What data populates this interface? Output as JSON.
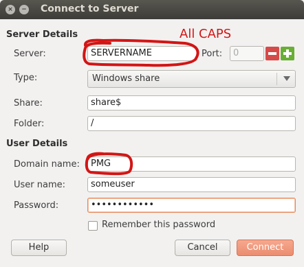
{
  "window": {
    "title": "Connect to Server",
    "close_icon": "×",
    "minimize_icon": "−"
  },
  "server_details": {
    "heading": "Server Details",
    "server_label": "Server:",
    "server_value": "SERVERNAME",
    "port_label": "Port:",
    "port_value": "0",
    "type_label": "Type:",
    "type_value": "Windows share",
    "share_label": "Share:",
    "share_value": "share$",
    "folder_label": "Folder:",
    "folder_value": "/"
  },
  "user_details": {
    "heading": "User Details",
    "domain_label": "Domain name:",
    "domain_value": "PMG",
    "username_label": "User name:",
    "username_value": "someuser",
    "password_label": "Password:",
    "password_value": "••••••••••••",
    "remember_label": "Remember this password"
  },
  "buttons": {
    "help": "Help",
    "cancel": "Cancel",
    "connect": "Connect"
  },
  "annotation": {
    "text": "All CAPS",
    "color": "#d31515"
  }
}
